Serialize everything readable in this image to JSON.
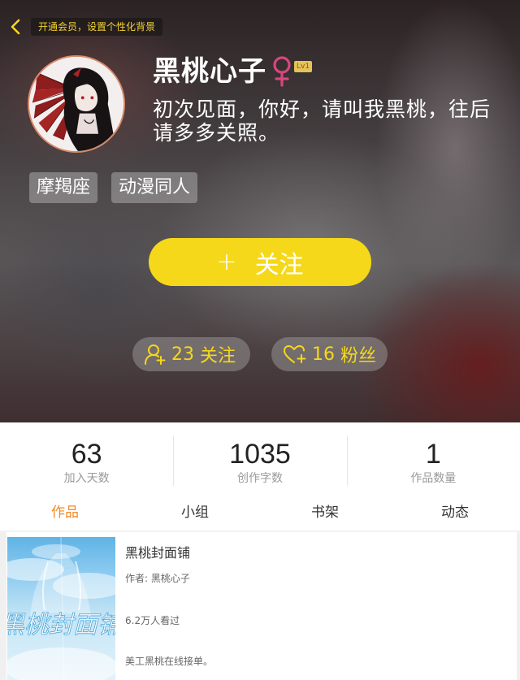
{
  "colors": {
    "accent_yellow": "#f5d81a",
    "tab_active": "#f08a26",
    "vip_text": "#f4d433"
  },
  "top_bar": {
    "back_icon": "chevron-left-icon",
    "vip_promo": "开通会员，设置个性化背景"
  },
  "profile": {
    "nickname": "黑桃心子",
    "gender_icon": "female-icon",
    "level": "Lv1",
    "bio": "初次见面，你好，请叫我黑桃，往后请多多关照。",
    "tags": [
      "摩羯座",
      "动漫同人"
    ],
    "follow_button": {
      "icon": "+",
      "label": "关注"
    },
    "following": {
      "icon": "user-add-icon",
      "count": "23",
      "label": "关注"
    },
    "fans": {
      "icon": "heart-add-icon",
      "count": "16",
      "label": "粉丝"
    }
  },
  "stats": [
    {
      "value": "63",
      "label": "加入天数"
    },
    {
      "value": "1035",
      "label": "创作字数"
    },
    {
      "value": "1",
      "label": "作品数量"
    }
  ],
  "tabs": [
    {
      "label": "作品",
      "active": true
    },
    {
      "label": "小组",
      "active": false
    },
    {
      "label": "书架",
      "active": false
    },
    {
      "label": "动态",
      "active": false
    }
  ],
  "works": [
    {
      "title": "黑桃封面铺",
      "author": "作者: 黑桃心子",
      "views": "6.2万人看过",
      "description": "美工黑桃在线接单。",
      "cover_text": "黑桃封面铺"
    }
  ]
}
